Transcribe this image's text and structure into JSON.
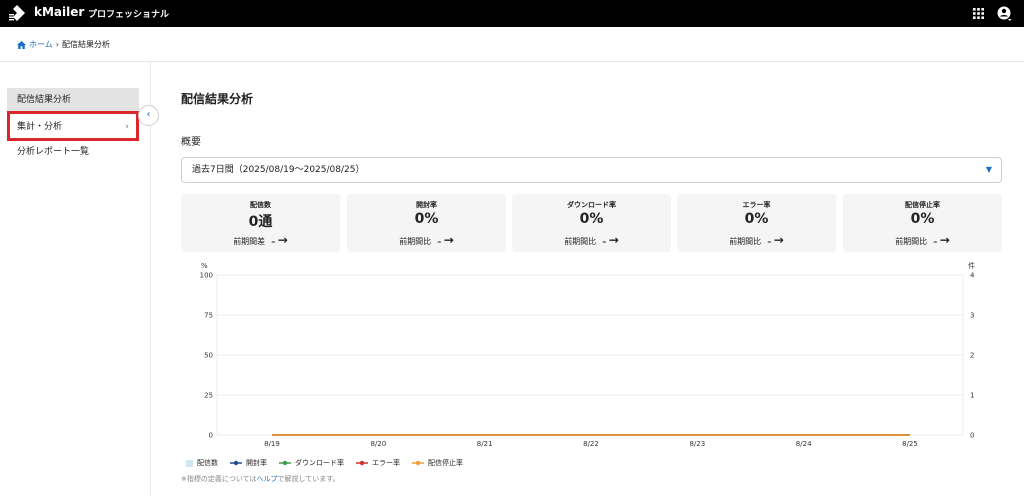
{
  "header": {
    "brand": "kMailer",
    "edition": "プロフェッショナル"
  },
  "breadcrumb": {
    "home": "ホーム",
    "separator": "›",
    "current": "配信結果分析"
  },
  "sidebar": {
    "items": [
      {
        "label": "配信結果分析"
      },
      {
        "label": "集計・分析",
        "chevron": "›"
      },
      {
        "label": "分析レポート一覧"
      }
    ],
    "collapse_glyph": "‹"
  },
  "main": {
    "title": "配信結果分析",
    "section": "概要",
    "period": "過去7日間（2025/08/19〜2025/08/25）",
    "kpis": [
      {
        "title": "配信数",
        "value": "0通",
        "compare_label": "前期間差",
        "compare_value": "–",
        "arrow": "→"
      },
      {
        "title": "開封率",
        "value": "0%",
        "compare_label": "前期間比",
        "compare_value": "–",
        "arrow": "→"
      },
      {
        "title": "ダウンロード率",
        "value": "0%",
        "compare_label": "前期間比",
        "compare_value": "–",
        "arrow": "→"
      },
      {
        "title": "エラー率",
        "value": "0%",
        "compare_label": "前期間比",
        "compare_value": "–",
        "arrow": "→"
      },
      {
        "title": "配信停止率",
        "value": "0%",
        "compare_label": "前期間比",
        "compare_value": "–",
        "arrow": "→"
      }
    ],
    "note_prefix": "※指標の定義については",
    "note_link": "ヘルプ",
    "note_suffix": "で解説しています。"
  },
  "chart_data": {
    "type": "line",
    "categories": [
      "8/19",
      "8/20",
      "8/21",
      "8/22",
      "8/23",
      "8/24",
      "8/25"
    ],
    "left_unit": "%",
    "right_unit": "件",
    "y_left_ticks": [
      0,
      25,
      50,
      75,
      100
    ],
    "y_right_ticks": [
      0,
      1,
      2,
      3,
      4
    ],
    "ylim_left": [
      0,
      100
    ],
    "ylim_right": [
      0,
      4
    ],
    "series": [
      {
        "name": "配信数",
        "type": "bar",
        "axis": "right",
        "color": "#cfe6f6",
        "values": [
          0,
          0,
          0,
          0,
          0,
          0,
          0
        ]
      },
      {
        "name": "開封率",
        "type": "line",
        "axis": "left",
        "color": "#1f4e8c",
        "values": [
          0,
          0,
          0,
          0,
          0,
          0,
          0
        ]
      },
      {
        "name": "ダウンロード率",
        "type": "line",
        "axis": "left",
        "color": "#3a9a4a",
        "values": [
          0,
          0,
          0,
          0,
          0,
          0,
          0
        ]
      },
      {
        "name": "エラー率",
        "type": "line",
        "axis": "left",
        "color": "#d32f2f",
        "values": [
          0,
          0,
          0,
          0,
          0,
          0,
          0
        ]
      },
      {
        "name": "配信停止率",
        "type": "line",
        "axis": "left",
        "color": "#f0a030",
        "values": [
          0,
          0,
          0,
          0,
          0,
          0,
          0
        ]
      }
    ],
    "grid": true,
    "legend": "bottom-left"
  }
}
